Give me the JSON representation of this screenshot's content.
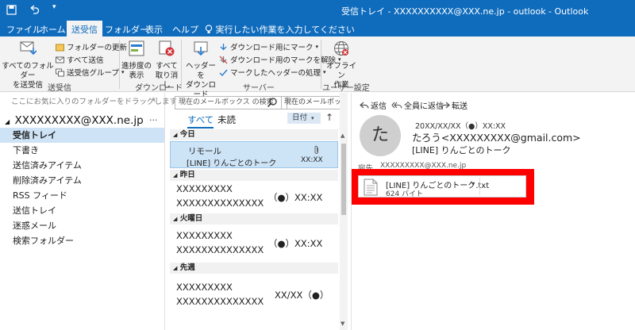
{
  "window": {
    "title": "受信トレイ - XXXXXXXXXX@XXX.ne.jp - outlook - Outlook"
  },
  "menu": {
    "tabs": [
      "ファイル",
      "ホーム",
      "送受信",
      "フォルダー",
      "表示",
      "ヘルプ"
    ],
    "active": "送受信",
    "tell_me": "実行したい作業を入力してください"
  },
  "ribbon": {
    "send_receive_all": "すべてのフォルダー\nを送受信",
    "update_folder": "フォルダーの更新",
    "send_all": "すべて送信",
    "send_receive_groups": "送受信グループ",
    "group_send_receive": "送受信",
    "show_progress": "進捗度の\n表示",
    "cancel_all": "すべて\n取り消し",
    "group_download": "ダウンロード",
    "download_headers": "ヘッダーを\nダウンロード",
    "mark_download": "ダウンロード用にマーク",
    "unmark_download": "ダウンロード用のマークを解除",
    "process_marked": "マークしたヘッダーの処理",
    "group_server": "サーバー",
    "work_offline": "オフライン\n作業",
    "group_preferences": "ユーザー設定"
  },
  "folders": {
    "favorites_hint": "ここにお気に入りのフォルダーをドラッグします",
    "account": "XXXXXXXXX@XXX.ne.jp",
    "account_more": "···",
    "items": [
      {
        "label": "受信トレイ",
        "selected": true
      },
      {
        "label": "下書き",
        "selected": false
      },
      {
        "label": "送信済みアイテム",
        "selected": false
      },
      {
        "label": "削除済みアイテム",
        "selected": false
      },
      {
        "label": "RSS フィード",
        "selected": false
      },
      {
        "label": "送信トレイ",
        "selected": false
      },
      {
        "label": "迷惑メール",
        "selected": false
      },
      {
        "label": "検索フォルダー",
        "selected": false
      }
    ]
  },
  "list": {
    "search_placeholder": "現在のメールボックス の検索",
    "scope": "現在のメールボックス",
    "filter_all": "すべて",
    "filter_unread": "未読",
    "sort_label": "日付",
    "groups": [
      {
        "label": "今日",
        "messages": [
          {
            "sender": "リモール",
            "subject": "[LINE] りんごとのトーク",
            "time": "XX:XX",
            "selected": true
          }
        ]
      },
      {
        "label": "昨日",
        "messages": [
          {
            "sender": "XXXXXXXXX",
            "subject": "XXXXXXXXXXXXXX",
            "time": "（●）XX:XX",
            "selected": false
          }
        ]
      },
      {
        "label": "火曜日",
        "messages": [
          {
            "sender": "XXXXXXXXX",
            "subject": "XXXXXXXXXXXXXX",
            "time": "（●）XX:XX",
            "selected": false
          }
        ]
      },
      {
        "label": "先週",
        "messages": [
          {
            "sender": "XXXXXXXXX",
            "subject": "XXXXXXXXXXXXXX",
            "time": "XX/XX（●）",
            "selected": false
          }
        ]
      }
    ]
  },
  "reading": {
    "reply": "返信",
    "reply_all": "全員に返信",
    "forward": "転送",
    "avatar_initial": "た",
    "date": "20XX/XX/XX（●）XX:XX",
    "from": "たろう<XXXXXXXXX@gmail.com>",
    "subject": "[LINE] りんごとのトーク",
    "to_label": "宛先",
    "to": "XXXXXXXXX@XXX.ne.jp",
    "attachment_name": "[LINE] りんごとのトーク.txt",
    "attachment_size": "624 バイト"
  },
  "colors": {
    "brand": "#0f6cbd",
    "selected_folder": "#cfe3f6",
    "selected_message": "#cde4f7",
    "highlight": "#ff0000"
  }
}
